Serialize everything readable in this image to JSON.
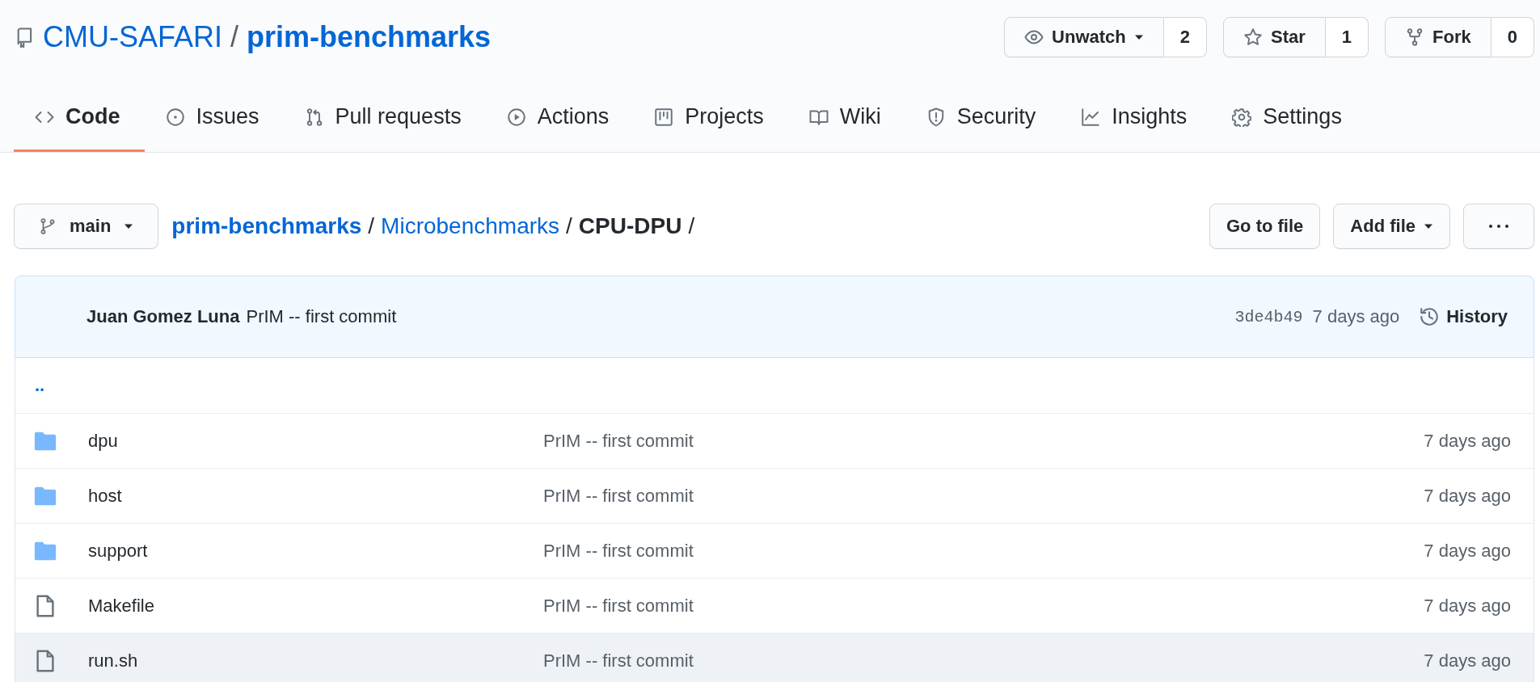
{
  "repo": {
    "owner": "CMU-SAFARI",
    "separator": "/",
    "name": "prim-benchmarks"
  },
  "repo_actions": [
    {
      "kind": "watch",
      "label": "Unwatch",
      "count": "2",
      "dropdown": true
    },
    {
      "kind": "star",
      "label": "Star",
      "count": "1",
      "dropdown": false
    },
    {
      "kind": "fork",
      "label": "Fork",
      "count": "0",
      "dropdown": false
    }
  ],
  "tabs": [
    {
      "kind": "code",
      "label": "Code",
      "selected": true
    },
    {
      "kind": "issues",
      "label": "Issues",
      "selected": false
    },
    {
      "kind": "pulls",
      "label": "Pull requests",
      "selected": false
    },
    {
      "kind": "actions",
      "label": "Actions",
      "selected": false
    },
    {
      "kind": "projects",
      "label": "Projects",
      "selected": false
    },
    {
      "kind": "wiki",
      "label": "Wiki",
      "selected": false
    },
    {
      "kind": "security",
      "label": "Security",
      "selected": false
    },
    {
      "kind": "insights",
      "label": "Insights",
      "selected": false
    },
    {
      "kind": "settings",
      "label": "Settings",
      "selected": false
    }
  ],
  "branch": {
    "name": "main"
  },
  "breadcrumb": [
    {
      "kind": "link",
      "label": "prim-benchmarks"
    },
    {
      "kind": "separator",
      "label": "/"
    },
    {
      "kind": "link",
      "label": "Microbenchmarks"
    },
    {
      "kind": "separator",
      "label": "/"
    },
    {
      "kind": "current",
      "label": "CPU-DPU"
    },
    {
      "kind": "separator",
      "label": "/"
    }
  ],
  "file_buttons": [
    {
      "kind": "plain",
      "label": "Go to file"
    },
    {
      "kind": "dropdown",
      "label": "Add file"
    },
    {
      "kind": "more"
    }
  ],
  "latest_commit": {
    "author": "Juan Gomez Luna",
    "message": "PrIM -- first commit",
    "sha": "3de4b49",
    "age": "7 days ago",
    "history": "History"
  },
  "parent_link": "..",
  "files": [
    {
      "kind": "dir",
      "name": "dpu",
      "message": "PrIM -- first commit",
      "age": "7 days ago",
      "highlighted": false
    },
    {
      "kind": "dir",
      "name": "host",
      "message": "PrIM -- first commit",
      "age": "7 days ago",
      "highlighted": false
    },
    {
      "kind": "dir",
      "name": "support",
      "message": "PrIM -- first commit",
      "age": "7 days ago",
      "highlighted": false
    },
    {
      "kind": "file",
      "name": "Makefile",
      "message": "PrIM -- first commit",
      "age": "7 days ago",
      "highlighted": false
    },
    {
      "kind": "file",
      "name": "run.sh",
      "message": "PrIM -- first commit",
      "age": "7 days ago",
      "highlighted": true
    }
  ]
}
